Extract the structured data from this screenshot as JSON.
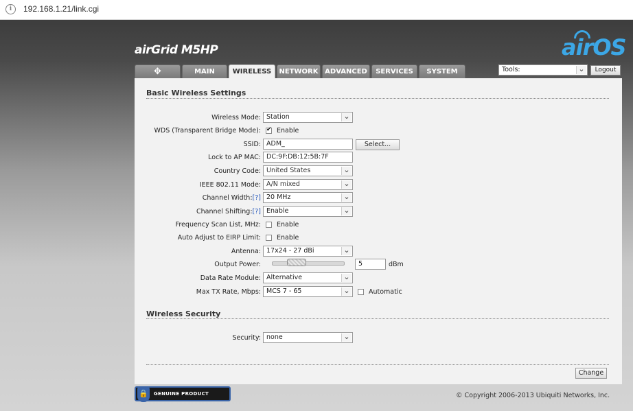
{
  "browser": {
    "url": "192.168.1.21/link.cgi"
  },
  "header": {
    "product_logo": "airGrid M5HP",
    "brand_logo": "airOS",
    "tabs": [
      {
        "label": ""
      },
      {
        "label": "MAIN"
      },
      {
        "label": "WIRELESS"
      },
      {
        "label": "NETWORK"
      },
      {
        "label": "ADVANCED"
      },
      {
        "label": "SERVICES"
      },
      {
        "label": "SYSTEM"
      }
    ],
    "active_tab": "WIRELESS",
    "tools_label": "Tools:",
    "logout_label": "Logout"
  },
  "basic": {
    "title": "Basic Wireless Settings",
    "wireless_mode": {
      "label": "Wireless Mode:",
      "value": "Station"
    },
    "wds": {
      "label": "WDS (Transparent Bridge Mode):",
      "checked": true,
      "option": "Enable"
    },
    "ssid": {
      "label": "SSID:",
      "value": "ADM_",
      "button": "Select..."
    },
    "lock_ap": {
      "label": "Lock to AP MAC:",
      "value": "DC:9F:DB:12:5B:7F"
    },
    "country": {
      "label": "Country Code:",
      "value": "United States"
    },
    "ieee": {
      "label": "IEEE 802.11 Mode:",
      "value": "A/N mixed"
    },
    "channel_width": {
      "label": "Channel Width:",
      "help": "[?]",
      "value": "20 MHz"
    },
    "channel_shifting": {
      "label": "Channel Shifting:",
      "help": "[?]",
      "value": "Enable"
    },
    "freq_scan": {
      "label": "Frequency Scan List, MHz:",
      "checked": false,
      "option": "Enable"
    },
    "auto_eirp": {
      "label": "Auto Adjust to EIRP Limit:",
      "checked": false,
      "option": "Enable"
    },
    "antenna": {
      "label": "Antenna:",
      "value": "17x24 - 27 dBi"
    },
    "output_power": {
      "label": "Output Power:",
      "value": "5",
      "unit": "dBm"
    },
    "data_rate": {
      "label": "Data Rate Module:",
      "value": "Alternative"
    },
    "max_tx": {
      "label": "Max TX Rate, Mbps:",
      "value": "MCS 7 - 65",
      "auto_checked": false,
      "auto_label": "Automatic"
    }
  },
  "security": {
    "title": "Wireless Security",
    "label": "Security:",
    "value": "none"
  },
  "change_label": "Change",
  "footer": {
    "badge": "GENUINE PRODUCT",
    "copyright": "© Copyright 2006-2013 Ubiquiti Networks, Inc."
  }
}
